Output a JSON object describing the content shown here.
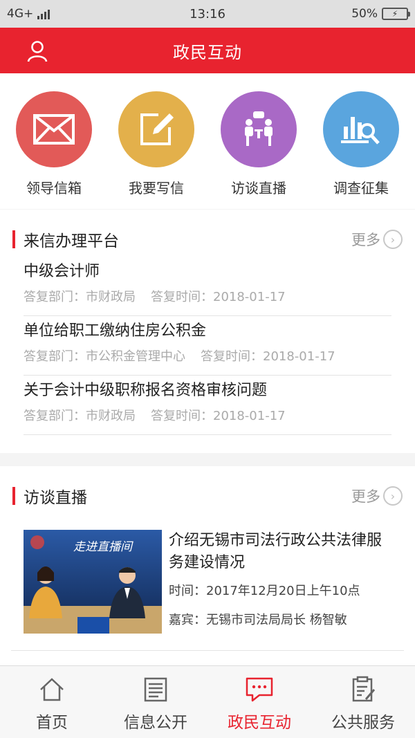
{
  "status": {
    "network": "4G+",
    "time": "13:16",
    "battery": "50%"
  },
  "header": {
    "title": "政民互动"
  },
  "quick_actions": [
    {
      "label": "领导信箱",
      "icon": "mail-icon",
      "color": "#e25a58"
    },
    {
      "label": "我要写信",
      "icon": "edit-icon",
      "color": "#e3b04b"
    },
    {
      "label": "访谈直播",
      "icon": "interview-icon",
      "color": "#a969c6"
    },
    {
      "label": "调查征集",
      "icon": "survey-icon",
      "color": "#5aa5de"
    }
  ],
  "letters_section": {
    "title": "来信办理平台",
    "more": "更多",
    "items": [
      {
        "title": "中级会计师",
        "dept_label": "答复部门：",
        "dept": "市财政局",
        "time_label": "答复时间：",
        "time": "2018-01-17"
      },
      {
        "title": "单位给职工缴纳住房公积金",
        "dept_label": "答复部门：",
        "dept": "市公积金管理中心",
        "time_label": "答复时间：",
        "time": "2018-01-17"
      },
      {
        "title": "关于会计中级职称报名资格审核问题",
        "dept_label": "答复部门：",
        "dept": "市财政局",
        "time_label": "答复时间：",
        "time": "2018-01-17"
      }
    ]
  },
  "interview_section": {
    "title": "访谈直播",
    "more": "更多",
    "item": {
      "thumb_caption": "走进直播间",
      "title": "介绍无锡市司法行政公共法律服务建设情况",
      "time": "时间：2017年12月20日上午10点",
      "guest": "嘉宾：无锡市司法局局长  杨智敏"
    }
  },
  "tabs": [
    {
      "label": "首页",
      "icon": "home-icon"
    },
    {
      "label": "信息公开",
      "icon": "document-icon"
    },
    {
      "label": "政民互动",
      "icon": "chat-icon",
      "active": true
    },
    {
      "label": "公共服务",
      "icon": "clipboard-icon"
    }
  ],
  "colors": {
    "primary": "#e8232f"
  }
}
